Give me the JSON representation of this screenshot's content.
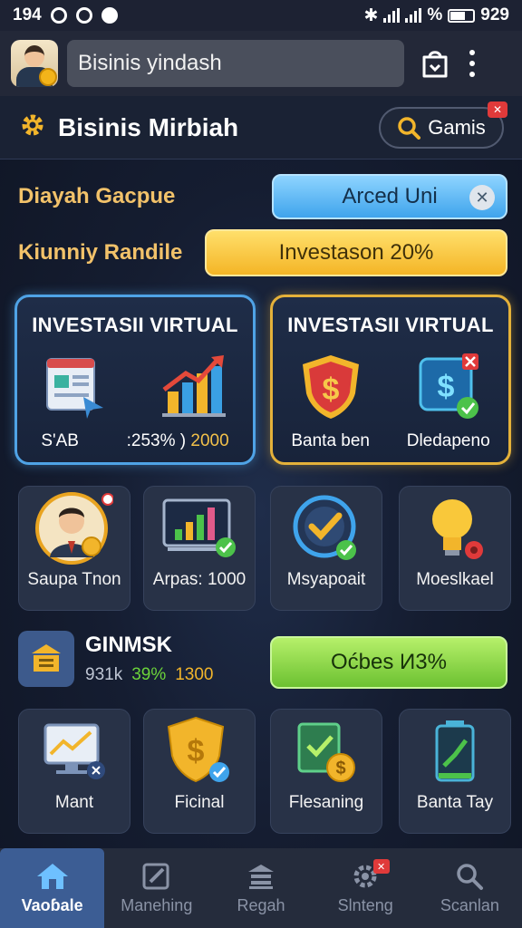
{
  "status_bar": {
    "time": "194",
    "battery_text": "%",
    "battery_value": "929"
  },
  "app_bar": {
    "search_value": "Bisinis yindash"
  },
  "section": {
    "title": "Bisinis Mirbiah",
    "games_button": "Gamis"
  },
  "filters": [
    {
      "label": "Diayah Gacpue",
      "value": "Arced Uni"
    },
    {
      "label": "Kiunniy Randile",
      "value": "Investason 20%"
    }
  ],
  "investment_cards": [
    {
      "title": "INVESTASII VIRTUAL",
      "captions": [
        "S'AB",
        ":253% ) ",
        "2000"
      ]
    },
    {
      "title": "INVESTASII VIRTUAL",
      "captions": [
        "Banta ben",
        "Dledapeno"
      ]
    }
  ],
  "tiles_row1": [
    "Saupa Tnon",
    "Arpas: 1000",
    "Msyapoait",
    "Moeslkael"
  ],
  "ginmsk": {
    "title": "GINMSK",
    "stat1": "931k",
    "stat2": "39%",
    "stat3": "1300",
    "button": "Oćbes И3%"
  },
  "tiles_row2": [
    "Mant",
    "Ficinal",
    "Flesaning",
    "Banta Tay"
  ],
  "bottom_nav": [
    "Vaoɓale",
    "Manehing",
    "Regah",
    "Slnteng",
    "Scanlan"
  ],
  "colors": {
    "accent_gold": "#e4b13a",
    "accent_blue": "#4fa3e6",
    "active_nav": "#3c5d94"
  }
}
